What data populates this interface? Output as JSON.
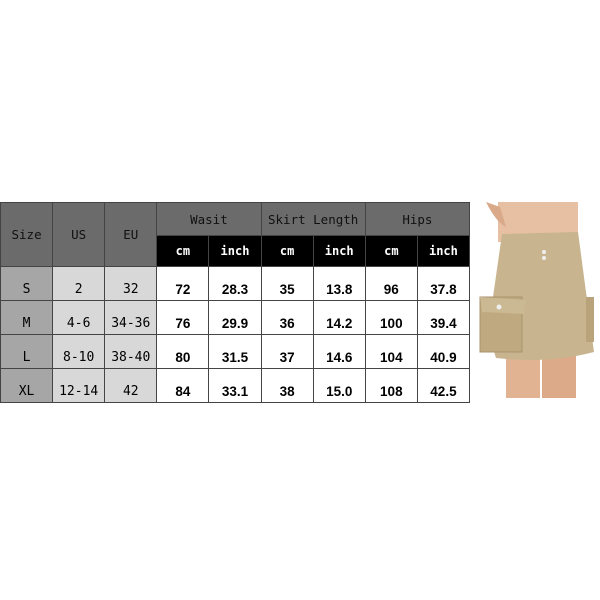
{
  "table": {
    "headers": {
      "size": "Size",
      "us": "US",
      "eu": "EU",
      "waist": "Wasit",
      "skirt_length": "Skirt Length",
      "hips": "Hips"
    },
    "units": [
      "cm",
      "inch",
      "cm",
      "inch",
      "cm",
      "inch"
    ],
    "rows": [
      [
        "S",
        "2",
        "32",
        "72",
        "28.3",
        "35",
        "13.8",
        "96",
        "37.8"
      ],
      [
        "M",
        "4-6",
        "34-36",
        "76",
        "29.9",
        "36",
        "14.2",
        "100",
        "39.4"
      ],
      [
        "L",
        "8-10",
        "38-40",
        "80",
        "31.5",
        "37",
        "14.6",
        "104",
        "40.9"
      ],
      [
        "XL",
        "12-14",
        "42",
        "84",
        "33.1",
        "38",
        "15.0",
        "108",
        "42.5"
      ]
    ]
  },
  "product": {
    "color": "#c8b58f",
    "icon": "khaki-cargo-mini-skirt-photo"
  }
}
